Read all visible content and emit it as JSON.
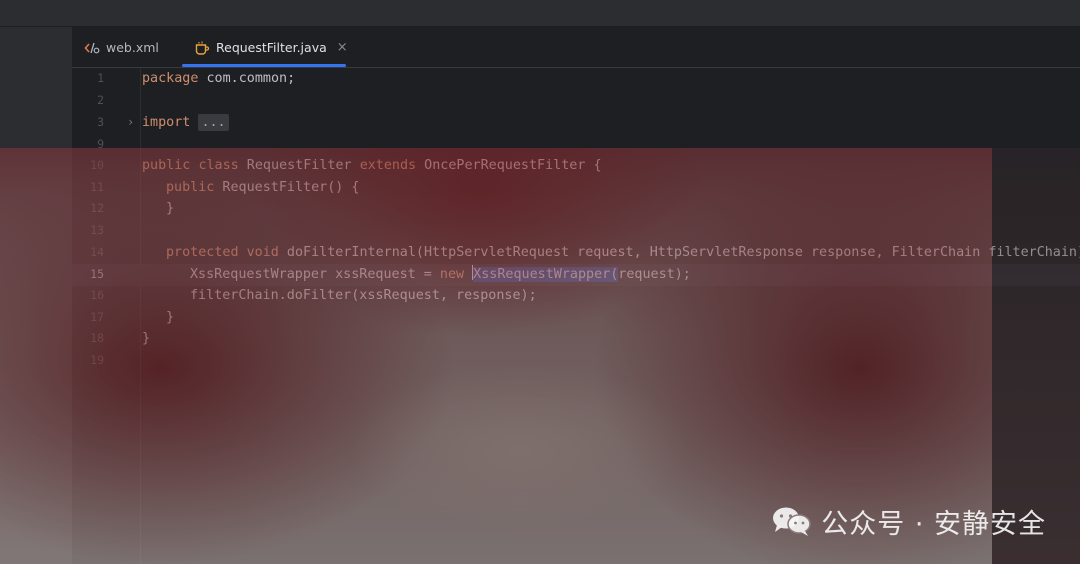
{
  "tabs": [
    {
      "label": "web.xml",
      "icon": "xml-file-icon",
      "active": false
    },
    {
      "label": "RequestFilter.java",
      "icon": "java-class-icon",
      "active": true,
      "close": "×"
    }
  ],
  "editor": {
    "current_line": "15",
    "lines": [
      {
        "num": "1"
      },
      {
        "num": "2"
      },
      {
        "num": "3"
      },
      {
        "num": "9"
      },
      {
        "num": "10"
      },
      {
        "num": "11"
      },
      {
        "num": "12"
      },
      {
        "num": "13"
      },
      {
        "num": "14"
      },
      {
        "num": "15"
      },
      {
        "num": "16"
      },
      {
        "num": "17"
      },
      {
        "num": "18"
      },
      {
        "num": "19"
      }
    ],
    "code": {
      "l1_kw": "package",
      "l1_rest": " com.common;",
      "l3_kw": "import",
      "l3_fold": "...",
      "l10_kw1": "public",
      "l10_kw2": "class",
      "l10_name": " RequestFilter ",
      "l10_kw3": "extends",
      "l10_rest": " OncePerRequestFilter {",
      "l11_kw": "public",
      "l11_rest": " RequestFilter() {",
      "l12": "}",
      "l14_kw1": "protected",
      "l14_kw2": "void",
      "l14_rest": " doFilterInternal(HttpServletRequest request, HttpServletResponse response, FilterChain filterChain) t",
      "l15_a": "XssRequestWrapper xssRequest = ",
      "l15_kw": "new",
      "l15_sel": "XssRequestWrapper(",
      "l15_rest": "request);",
      "l16": "filterChain.doFilter(xssRequest, response);",
      "l17": "}",
      "l18": "}"
    }
  },
  "watermark": {
    "text": "公众号 · 安静安全",
    "icon": "wechat-icon"
  },
  "colors": {
    "accent": "#3574f0",
    "keyword": "#cf8e6d",
    "selection": "#214283"
  }
}
